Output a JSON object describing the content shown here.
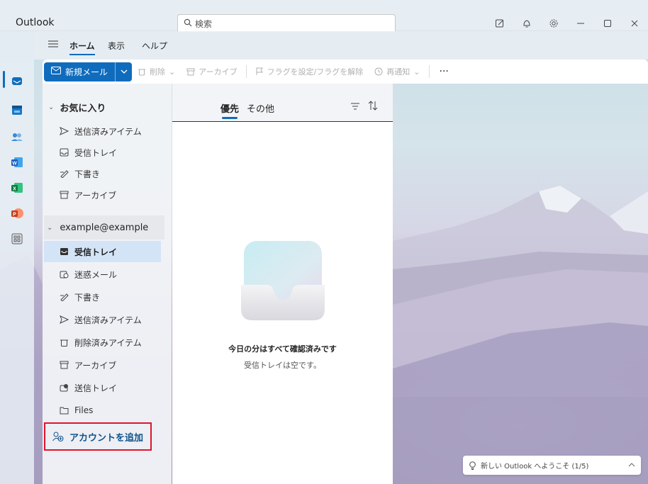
{
  "app": {
    "title": "Outlook"
  },
  "search": {
    "placeholder": "検索"
  },
  "menu": {
    "tabs": [
      "ホーム",
      "表示",
      "ヘルプ"
    ]
  },
  "ribbon": {
    "new_mail": "新規メール",
    "delete": "削除",
    "archive": "アーカイブ",
    "flag": "フラグを設定/フラグを解除",
    "snooze": "再通知",
    "more": "···"
  },
  "favorites": {
    "header": "お気に入り",
    "items": [
      "送信済みアイテム",
      "受信トレイ",
      "下書き",
      "アーカイブ"
    ]
  },
  "account": {
    "name": "example@example",
    "folders": [
      "受信トレイ",
      "迷惑メール",
      "下書き",
      "送信済みアイテム",
      "削除済みアイテム",
      "アーカイブ",
      "送信トレイ",
      "Files"
    ],
    "selected_index": 0
  },
  "add_account": "アカウントを追加",
  "message_list": {
    "tabs": [
      "優先",
      "その他"
    ],
    "active_tab": 0,
    "empty_title": "今日の分はすべて確認済みです",
    "empty_sub": "受信トレイは空です。"
  },
  "toast": {
    "text": "新しい Outlook へようこそ (1/5)"
  },
  "colors": {
    "accent": "#0f6cbd",
    "highlight_border": "#e0142c",
    "selected_folder": "#d4e4f7"
  }
}
